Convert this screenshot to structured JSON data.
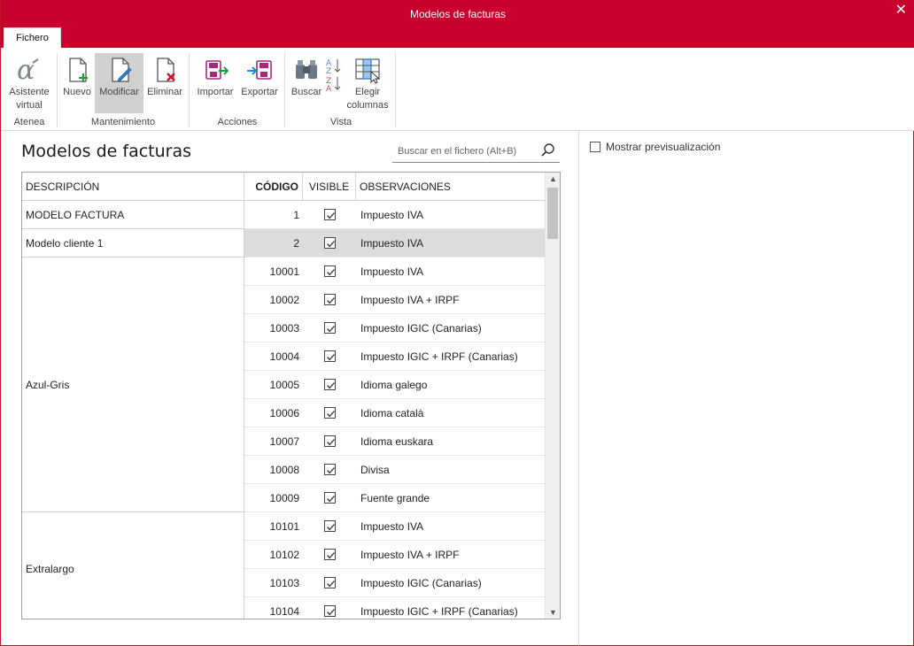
{
  "window": {
    "title": "Modelos de facturas",
    "close_glyph": "✕"
  },
  "tabs": [
    {
      "label": "Fichero"
    }
  ],
  "ribbon": {
    "groups": [
      {
        "label": "Atenea"
      },
      {
        "label": "Mantenimiento"
      },
      {
        "label": "Acciones"
      },
      {
        "label": "Vista"
      }
    ],
    "buttons": {
      "asistente": {
        "label1": "Asistente",
        "label2": "virtual",
        "icon": "alpha-icon"
      },
      "nuevo": {
        "label": "Nuevo",
        "icon": "new-document-icon"
      },
      "modificar": {
        "label": "Modificar",
        "icon": "edit-document-icon"
      },
      "eliminar": {
        "label": "Eliminar",
        "icon": "delete-document-icon"
      },
      "importar": {
        "label": "Importar",
        "icon": "import-icon"
      },
      "exportar": {
        "label": "Exportar",
        "icon": "export-icon"
      },
      "buscar": {
        "label": "Buscar",
        "icon": "binoculars-icon"
      },
      "sort": {
        "icon": "sort-az-icon"
      },
      "elegir": {
        "label1": "Elegir",
        "label2": "columnas",
        "icon": "columns-icon"
      }
    }
  },
  "main": {
    "title": "Modelos de facturas",
    "search_placeholder": "Buscar en el fichero (Alt+B)",
    "preview_label": "Mostrar previsualización"
  },
  "table": {
    "columns": {
      "descripcion": "DESCRIPCIÓN",
      "codigo": "CÓDIGO",
      "visible": "VISIBLE",
      "observaciones": "OBSERVACIONES"
    },
    "groups": [
      {
        "description": "MODELO FACTURA",
        "rows": 1
      },
      {
        "description": "Modelo cliente 1",
        "rows": 1
      },
      {
        "description": "Azul-Gris",
        "rows": 9
      },
      {
        "description": "Extralargo",
        "rows": 4
      }
    ],
    "rows": [
      {
        "code": "1",
        "visible": true,
        "obs": "Impuesto IVA"
      },
      {
        "code": "2",
        "visible": true,
        "obs": "Impuesto IVA",
        "selected": true
      },
      {
        "code": "10001",
        "visible": true,
        "obs": "Impuesto IVA"
      },
      {
        "code": "10002",
        "visible": true,
        "obs": "Impuesto IVA + IRPF"
      },
      {
        "code": "10003",
        "visible": true,
        "obs": "Impuesto IGIC (Canarias)"
      },
      {
        "code": "10004",
        "visible": true,
        "obs": "Impuesto IGIC + IRPF (Canarias)"
      },
      {
        "code": "10005",
        "visible": true,
        "obs": "Idioma galego"
      },
      {
        "code": "10006",
        "visible": true,
        "obs": "Idioma català"
      },
      {
        "code": "10007",
        "visible": true,
        "obs": "Idioma euskara"
      },
      {
        "code": "10008",
        "visible": true,
        "obs": "Divisa"
      },
      {
        "code": "10009",
        "visible": true,
        "obs": "Fuente grande"
      },
      {
        "code": "10101",
        "visible": true,
        "obs": "Impuesto IVA"
      },
      {
        "code": "10102",
        "visible": true,
        "obs": "Impuesto IVA + IRPF"
      },
      {
        "code": "10103",
        "visible": true,
        "obs": "Impuesto IGIC (Canarias)"
      },
      {
        "code": "10104",
        "visible": true,
        "obs": "Impuesto IGIC + IRPF (Canarias)"
      }
    ]
  },
  "colors": {
    "accent": "#c8002d",
    "selected_row": "#dcdcdc"
  }
}
